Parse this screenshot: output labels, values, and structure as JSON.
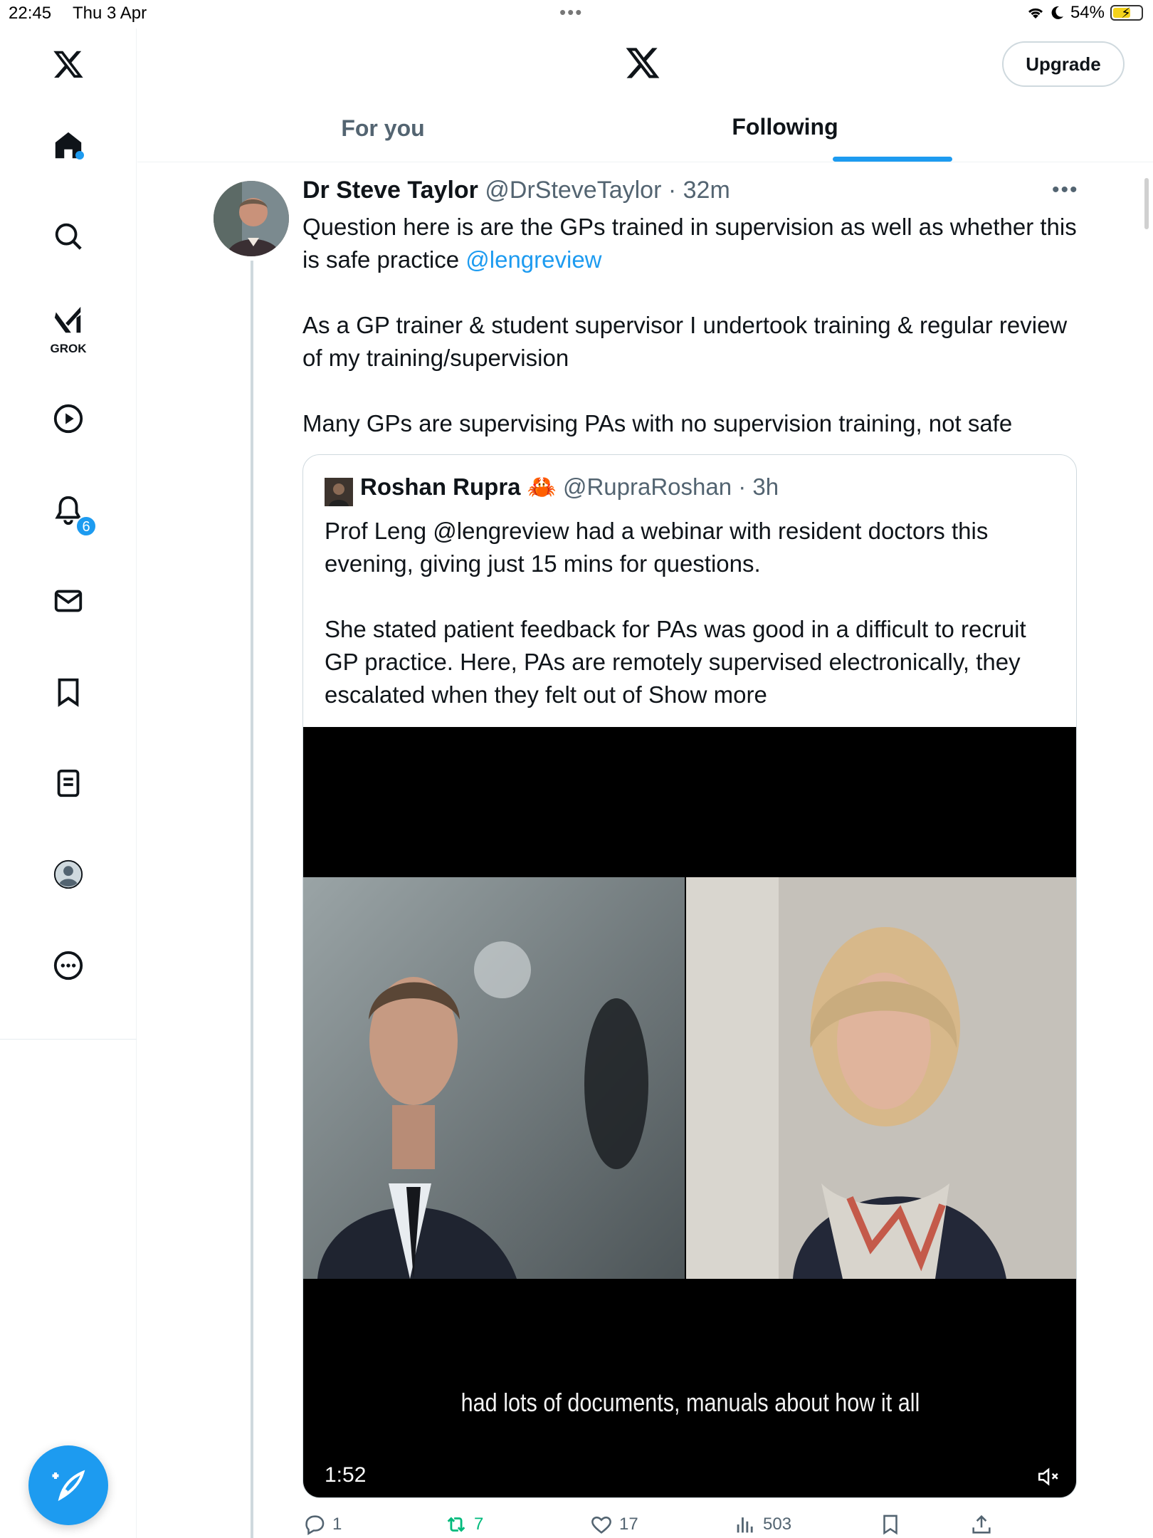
{
  "status_bar": {
    "time": "22:45",
    "date": "Thu 3 Apr",
    "battery_percent": "54%"
  },
  "sidebar": {
    "items": [
      {
        "name": "home",
        "icon": "home-icon"
      },
      {
        "name": "explore",
        "icon": "search-icon"
      },
      {
        "name": "grok",
        "icon": "grok-icon",
        "label": "GROK"
      },
      {
        "name": "video",
        "icon": "play-icon"
      },
      {
        "name": "notifications",
        "icon": "bell-icon",
        "badge": "6"
      },
      {
        "name": "messages",
        "icon": "mail-icon"
      },
      {
        "name": "bookmarks",
        "icon": "bookmark-icon"
      },
      {
        "name": "lists",
        "icon": "list-icon"
      },
      {
        "name": "profile",
        "icon": "avatar-icon"
      },
      {
        "name": "more",
        "icon": "more-circle-icon"
      }
    ],
    "compose_icon": "compose-icon"
  },
  "header": {
    "upgrade_label": "Upgrade",
    "tabs": [
      {
        "label": "For you",
        "active": false
      },
      {
        "label": "Following",
        "active": true
      }
    ]
  },
  "tweet": {
    "name": "Dr Steve Taylor",
    "handle": "@DrSteveTaylor",
    "time": "32m",
    "text_p1_a": "Question here is are the GPs trained in supervision as well as whether this is safe practice ",
    "text_p1_mention": "@lengreview",
    "text_p2": "As a GP trainer & student supervisor I undertook training  & regular review of my training/supervision",
    "text_p3": "Many GPs are supervising PAs with no supervision training, not safe",
    "quote": {
      "name": "Roshan Rupra",
      "emoji": "🦀",
      "handle": "@RupraRoshan",
      "time": "3h",
      "text_p1": "Prof Leng @lengreview had a webinar with resident doctors this evening, giving just 15 mins for questions.",
      "text_p2": "She stated patient feedback for PAs was good in a difficult to recruit GP practice. Here, PAs are remotely supervised electronically, they escalated when they felt out of ",
      "show_more": "Show more",
      "video": {
        "subtitle": "had lots of documents, manuals about how it all",
        "duration": "1:52",
        "muted": true
      }
    },
    "actions": {
      "replies": "1",
      "reposts": "7",
      "likes": "17",
      "views": "503"
    },
    "colors": {
      "accent": "#1d9bf0",
      "repost_active": "#00ba7c"
    }
  }
}
